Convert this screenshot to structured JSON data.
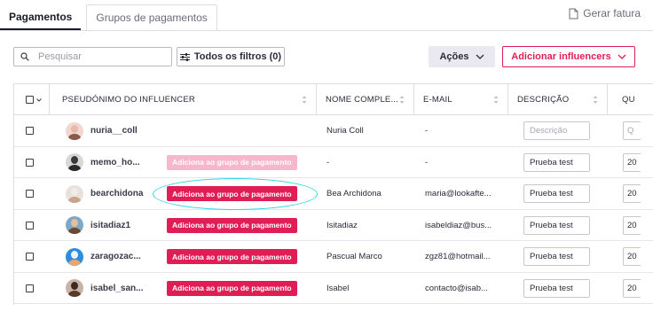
{
  "tabs": [
    {
      "label": "Pagamentos",
      "active": true
    },
    {
      "label": "Grupos de pagamentos",
      "active": false
    }
  ],
  "header": {
    "gerar_fatura": "Gerar fatura"
  },
  "toolbar": {
    "search_placeholder": "Pesquisar",
    "filters_label": "Todos os filtros (0)",
    "actions_label": "Ações",
    "add_influencers_label": "Adicionar influencers"
  },
  "table": {
    "columns": [
      "PSEUDÓNIMO DO INFLUENCER",
      "NOME COMPLE...",
      "E-MAIL",
      "DESCRIÇÃO",
      "QU"
    ],
    "rows": [
      {
        "username": "nuria__coll",
        "badge": "",
        "badge_style": "none",
        "full_name": "Nuria Coll",
        "email": "-",
        "description": "",
        "description_placeholder": "Descrição",
        "qty": "",
        "qty_placeholder": "Q",
        "avatar_colors": [
          "#f3d6cf",
          "#8a5a48",
          "#e8b8a8"
        ]
      },
      {
        "username": "memo_ho...",
        "badge": "Adiciona ao grupo de pagamento",
        "badge_style": "light",
        "full_name": "-",
        "email": "-",
        "description": "Prueba test",
        "description_placeholder": "",
        "qty": "20",
        "qty_placeholder": "",
        "avatar_colors": [
          "#d8d8d8",
          "#2a2a2a",
          "#3a3a3a"
        ]
      },
      {
        "username": "bearchidona",
        "badge": "Adiciona ao grupo de pagamento",
        "badge_style": "solid",
        "full_name": "Bea Archidona",
        "email": "maria@lookafte...",
        "description": "Prueba test",
        "description_placeholder": "",
        "qty": "20",
        "qty_placeholder": "",
        "avatar_colors": [
          "#e9e2dc",
          "#c9a48a",
          "#f2ece6"
        ]
      },
      {
        "username": "isitadiaz1",
        "badge": "Adiciona ao grupo de pagamento",
        "badge_style": "solid",
        "full_name": "Isitadiaz",
        "email": "isabeldiaz@bus...",
        "description": "Prueba test",
        "description_placeholder": "",
        "qty": "20",
        "qty_placeholder": "",
        "avatar_colors": [
          "#7fa7c7",
          "#6b4a32",
          "#e6c09a"
        ]
      },
      {
        "username": "zaragozac...",
        "badge": "Adiciona ao grupo de pagamento",
        "badge_style": "solid",
        "full_name": "Pascual Marco",
        "email": "zgz81@hotmail...",
        "description": "Prueba test",
        "description_placeholder": "",
        "qty": "20",
        "qty_placeholder": "",
        "avatar_colors": [
          "#2d8de0",
          "#e2a77a",
          "#f4f4f4"
        ]
      },
      {
        "username": "isabel_san...",
        "badge": "Adiciona ao grupo de pagamento",
        "badge_style": "solid",
        "full_name": "Isabel",
        "email": "contacto@isab...",
        "description": "Prueba test",
        "description_placeholder": "",
        "qty": "20",
        "qty_placeholder": "",
        "avatar_colors": [
          "#c8b3a6",
          "#5a3a2a",
          "#3a2a22"
        ]
      }
    ]
  },
  "colors": {
    "accent": "#e11d56",
    "accent_light": "#f7b6cb",
    "highlight": "#2ad4e6"
  }
}
